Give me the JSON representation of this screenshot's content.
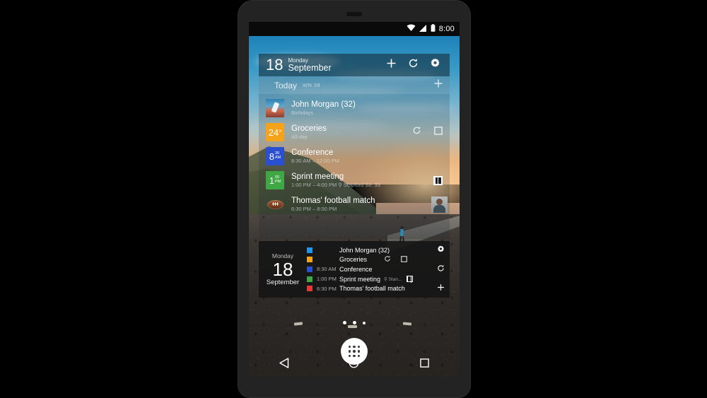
{
  "device": {
    "name": "android-phone"
  },
  "status_bar": {
    "wifi_icon": "wifi-icon",
    "signal_icon": "cellular-signal-icon",
    "battery_icon": "battery-icon",
    "clock": "8:00"
  },
  "widget_agenda": {
    "header": {
      "day_number": "18",
      "day_name": "Monday",
      "month": "September",
      "add_label": "+",
      "refresh_icon": "refresh-icon",
      "settings_icon": "gear-icon"
    },
    "section": {
      "label": "Today",
      "week_number": "WN 38",
      "add_label": "+"
    },
    "events": [
      {
        "title": "John Morgan (32)",
        "subtitle": "Birthdays",
        "badge_type": "photo",
        "badge_photo": "windsurfer-photo",
        "badge_color": "#3f9bc8",
        "badge_num": "",
        "badge_sup": "",
        "icons": []
      },
      {
        "title": "Groceries",
        "subtitle": "All-day",
        "badge_type": "date",
        "badge_color": "#f5a31b",
        "badge_num": "24",
        "badge_sup": "h",
        "icons": [
          "recurring-icon",
          "checkbox-icon"
        ]
      },
      {
        "title": "Conference",
        "subtitle": "8:30 AM – 12:00 PM",
        "badge_type": "date",
        "badge_color": "#2b4fd1",
        "badge_num": "8",
        "badge_sup": "30\nAM",
        "icons": []
      },
      {
        "title": "Sprint meeting",
        "subtitle": "1:00 PM – 4:00 PM   ⚲ Stapford Str. 33",
        "badge_type": "date",
        "badge_color": "#3fa743",
        "badge_num": "1",
        "badge_sup": "00\nPM",
        "icons": [
          "map-icon"
        ]
      },
      {
        "title": "Thomas' football match",
        "subtitle": "6:30 PM – 8:00 PM",
        "badge_type": "ball",
        "badge_color": "#7b3f21",
        "badge_num": "",
        "badge_sup": "",
        "icons": [
          "contact-avatar"
        ]
      }
    ]
  },
  "widget_compact": {
    "day_name": "Monday",
    "day_number": "18",
    "month": "September",
    "rows": [
      {
        "color": "#2196f3",
        "time": "",
        "title": "John Morgan (32)",
        "location": "",
        "icons": []
      },
      {
        "color": "#f5a31b",
        "time": "",
        "title": "Groceries",
        "location": "",
        "icons": [
          "recurring-icon",
          "checkbox-icon"
        ]
      },
      {
        "color": "#2b4fd1",
        "time": "8:30 AM",
        "title": "Conference",
        "location": "",
        "icons": []
      },
      {
        "color": "#3fa743",
        "time": "1:00 PM",
        "title": "Sprint meeting",
        "location": "⚲ Stan...",
        "icons": [
          "map-icon"
        ]
      },
      {
        "color": "#e53935",
        "time": "6:30 PM",
        "title": "Thomas' football match",
        "location": "",
        "icons": []
      }
    ],
    "actions": {
      "settings_icon": "gear-icon",
      "refresh_icon": "refresh-icon",
      "add_label": "+"
    }
  },
  "home_screen": {
    "page_dots": 3,
    "app_drawer_icon": "app-drawer-icon"
  },
  "nav_bar": {
    "back_icon": "back-triangle-icon",
    "home_icon": "home-circle-icon",
    "recents_icon": "recents-square-icon"
  },
  "colors": {
    "accent_blue": "#2196f3",
    "orange": "#f5a31b",
    "green": "#3fa743",
    "red": "#e53935",
    "dark_widget_bg": "#141414"
  }
}
